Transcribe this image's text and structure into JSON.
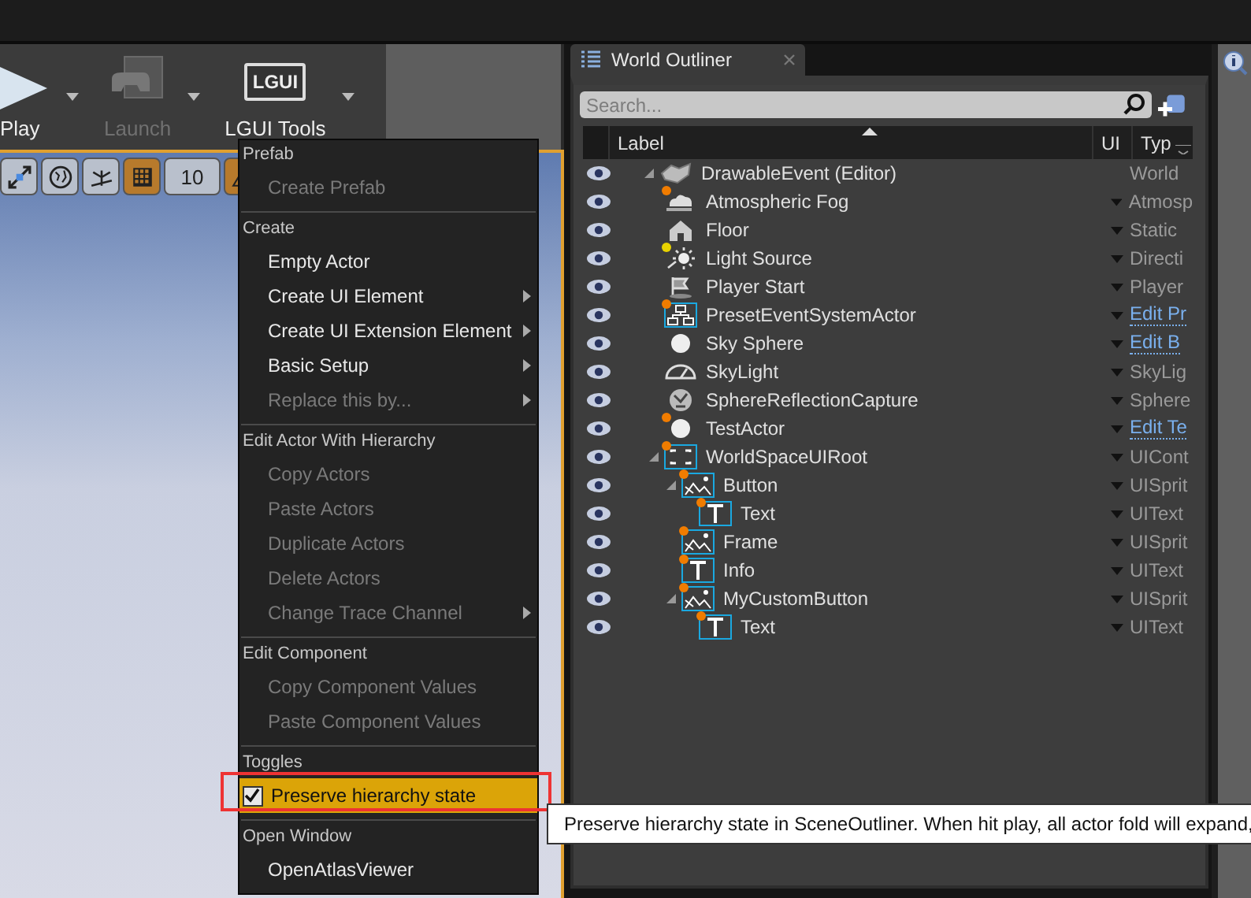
{
  "toolbar": {
    "buttons": [
      {
        "kind": "play",
        "label": "Play",
        "disabled": false
      },
      {
        "kind": "launch",
        "label": "Launch",
        "disabled": true
      },
      {
        "kind": "lgui",
        "label": "LGUI Tools",
        "icon_text": "LGUI",
        "disabled": false
      }
    ]
  },
  "viewport_toolbar": {
    "grid_snap": true,
    "grid_value": "10"
  },
  "context_menu": {
    "sections": [
      {
        "heading": "Prefab",
        "items": [
          {
            "kind": "action",
            "label": "Create Prefab",
            "disabled": true,
            "submenu": false,
            "hovered": false
          }
        ]
      },
      {
        "heading": "Create",
        "items": [
          {
            "kind": "action",
            "label": "Empty Actor",
            "disabled": false,
            "submenu": false,
            "hovered": false
          },
          {
            "kind": "action",
            "label": "Create UI Element",
            "disabled": false,
            "submenu": true,
            "hovered": false
          },
          {
            "kind": "action",
            "label": "Create UI Extension Element",
            "disabled": false,
            "submenu": true,
            "hovered": false
          },
          {
            "kind": "action",
            "label": "Basic Setup",
            "disabled": false,
            "submenu": true,
            "hovered": false
          },
          {
            "kind": "action",
            "label": "Replace this by...",
            "disabled": true,
            "submenu": true,
            "hovered": false
          }
        ]
      },
      {
        "heading": "Edit Actor With Hierarchy",
        "items": [
          {
            "kind": "action",
            "label": "Copy Actors",
            "disabled": true,
            "submenu": false,
            "hovered": false
          },
          {
            "kind": "action",
            "label": "Paste Actors",
            "disabled": true,
            "submenu": false,
            "hovered": false
          },
          {
            "kind": "action",
            "label": "Duplicate Actors",
            "disabled": true,
            "submenu": false,
            "hovered": false
          },
          {
            "kind": "action",
            "label": "Delete Actors",
            "disabled": true,
            "submenu": false,
            "hovered": false
          },
          {
            "kind": "action",
            "label": "Change Trace Channel",
            "disabled": true,
            "submenu": true,
            "hovered": false
          }
        ]
      },
      {
        "heading": "Edit Component",
        "items": [
          {
            "kind": "action",
            "label": "Copy Component Values",
            "disabled": true,
            "submenu": false,
            "hovered": false
          },
          {
            "kind": "action",
            "label": "Paste Component Values",
            "disabled": true,
            "submenu": false,
            "hovered": false
          }
        ]
      },
      {
        "heading": "Toggles",
        "items": [
          {
            "kind": "toggle",
            "label": "Preserve hierarchy state",
            "hovered": true,
            "checked": true
          }
        ]
      },
      {
        "heading": "Open Window",
        "items": [
          {
            "kind": "action",
            "label": "OpenAtlasViewer",
            "disabled": false,
            "submenu": false,
            "hovered": false
          }
        ]
      }
    ]
  },
  "tooltip": {
    "text": "Preserve hierarchy state in SceneOutliner. When hit play, all actor fold will expand,"
  },
  "outliner": {
    "tab": "World Outliner",
    "search": {
      "placeholder": "Search..."
    },
    "columns": [
      "Label",
      "UI",
      "Typ"
    ],
    "rows": [
      {
        "kind": "world",
        "label": "DrawableEvent (Editor)",
        "type": "World",
        "type_link": false,
        "expanded": true,
        "children": [
          {
            "kind": "fog",
            "label": "Atmospheric Fog",
            "type": "Atmosp",
            "type_link": false,
            "color": "#f07c00"
          },
          {
            "kind": "house",
            "label": "Floor",
            "type": "Static",
            "type_link": false
          },
          {
            "kind": "light",
            "label": "Light Source",
            "type": "Directi",
            "type_link": false,
            "color": "#e8d200"
          },
          {
            "kind": "player",
            "label": "Player Start",
            "type": "Player",
            "type_link": false
          },
          {
            "kind": "network",
            "label": "PresetEventSystemActor",
            "type": "Edit Pr",
            "type_link": true,
            "color": "#f07c00"
          },
          {
            "kind": "sphere",
            "label": "Sky Sphere",
            "type": "Edit B",
            "type_link": true
          },
          {
            "kind": "gauge",
            "label": "SkyLight",
            "type": "SkyLig",
            "type_link": false
          },
          {
            "kind": "reflection",
            "label": "SphereReflectionCapture",
            "type": "Sphere",
            "type_link": false
          },
          {
            "kind": "sphere",
            "label": "TestActor",
            "type": "Edit Te",
            "type_link": true,
            "color": "#f07c00"
          },
          {
            "kind": "frame",
            "label": "WorldSpaceUIRoot",
            "type": "UICont",
            "type_link": false,
            "color": "#f07c00",
            "expanded": true,
            "children": [
              {
                "kind": "sprite",
                "label": "Button",
                "type": "UISprit",
                "type_link": false,
                "color": "#f07c00",
                "expanded": true,
                "children": [
                  {
                    "kind": "text",
                    "label": "Text",
                    "type": "UIText",
                    "type_link": false,
                    "color": "#f07c00"
                  }
                ]
              },
              {
                "kind": "sprite",
                "label": "Frame",
                "type": "UISprit",
                "type_link": false,
                "color": "#f07c00"
              },
              {
                "kind": "text",
                "label": "Info",
                "type": "UIText",
                "type_link": false,
                "color": "#f07c00"
              },
              {
                "kind": "sprite",
                "label": "MyCustomButton",
                "type": "UISprit",
                "type_link": false,
                "color": "#f07c00",
                "expanded": true,
                "children": [
                  {
                    "kind": "text",
                    "label": "Text",
                    "type": "UIText",
                    "type_link": false,
                    "color": "#f07c00"
                  }
                ]
              }
            ]
          }
        ]
      }
    ]
  }
}
